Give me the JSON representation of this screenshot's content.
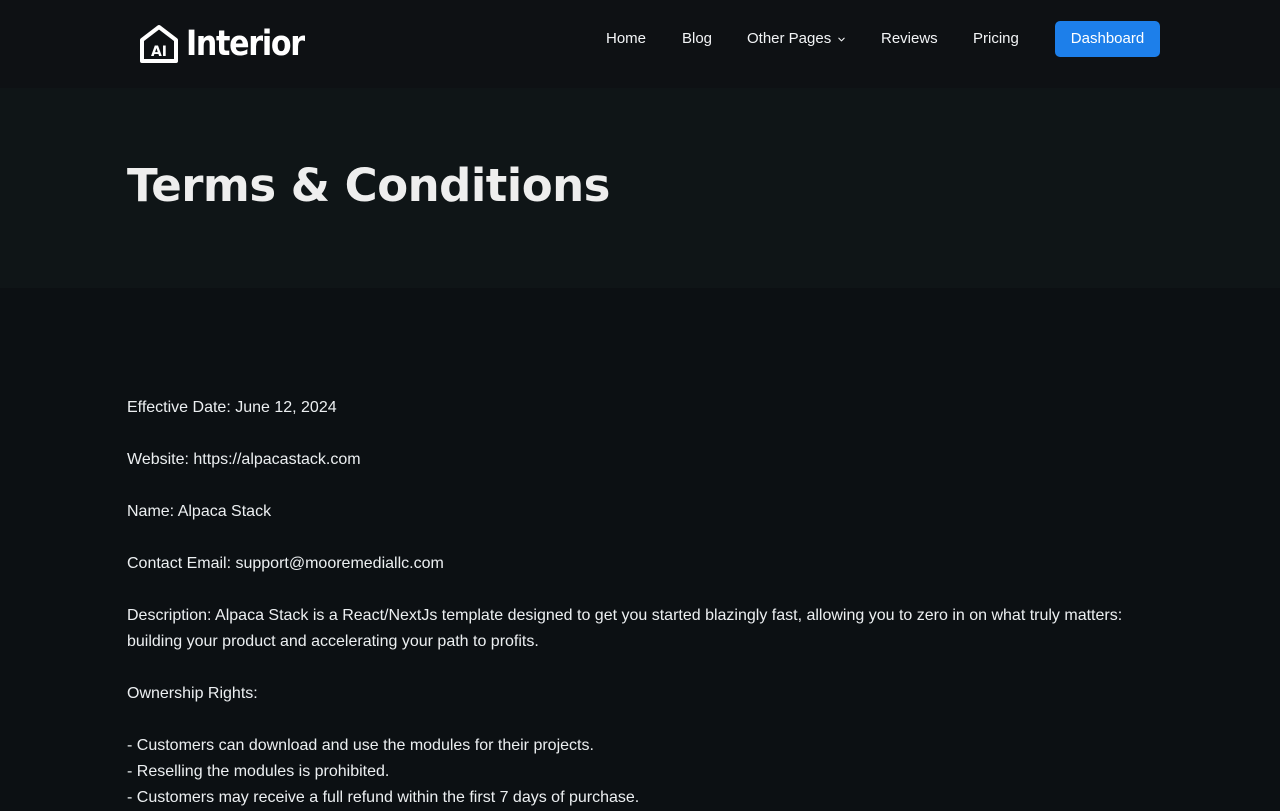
{
  "brand": {
    "icon_text": "AI",
    "name": "Interior"
  },
  "nav": {
    "home": "Home",
    "blog": "Blog",
    "other_pages": "Other Pages",
    "reviews": "Reviews",
    "pricing": "Pricing",
    "dashboard": "Dashboard"
  },
  "colors": {
    "accent": "#1d7fea",
    "header_bg": "#0e1114",
    "hero_bg": "#0f1517",
    "page_bg": "#0c1013"
  },
  "hero": {
    "title": "Terms & Conditions"
  },
  "content": {
    "effective_date": "Effective Date: June 12, 2024",
    "website": "Website: https://alpacastack.com",
    "name": "Name: Alpaca Stack",
    "contact_email": "Contact Email: support@mooremediallc.com",
    "description": "Description: Alpaca Stack is a React/NextJs template designed to get you started blazingly fast, allowing you to zero in on what truly matters: building your product and accelerating your path to profits.",
    "ownership_heading": "Ownership Rights:",
    "ownership_items": [
      "- Customers can download and use the modules for their projects.",
      "- Reselling the modules is prohibited.",
      "- Customers may receive a full refund within the first 7 days of purchase."
    ]
  }
}
